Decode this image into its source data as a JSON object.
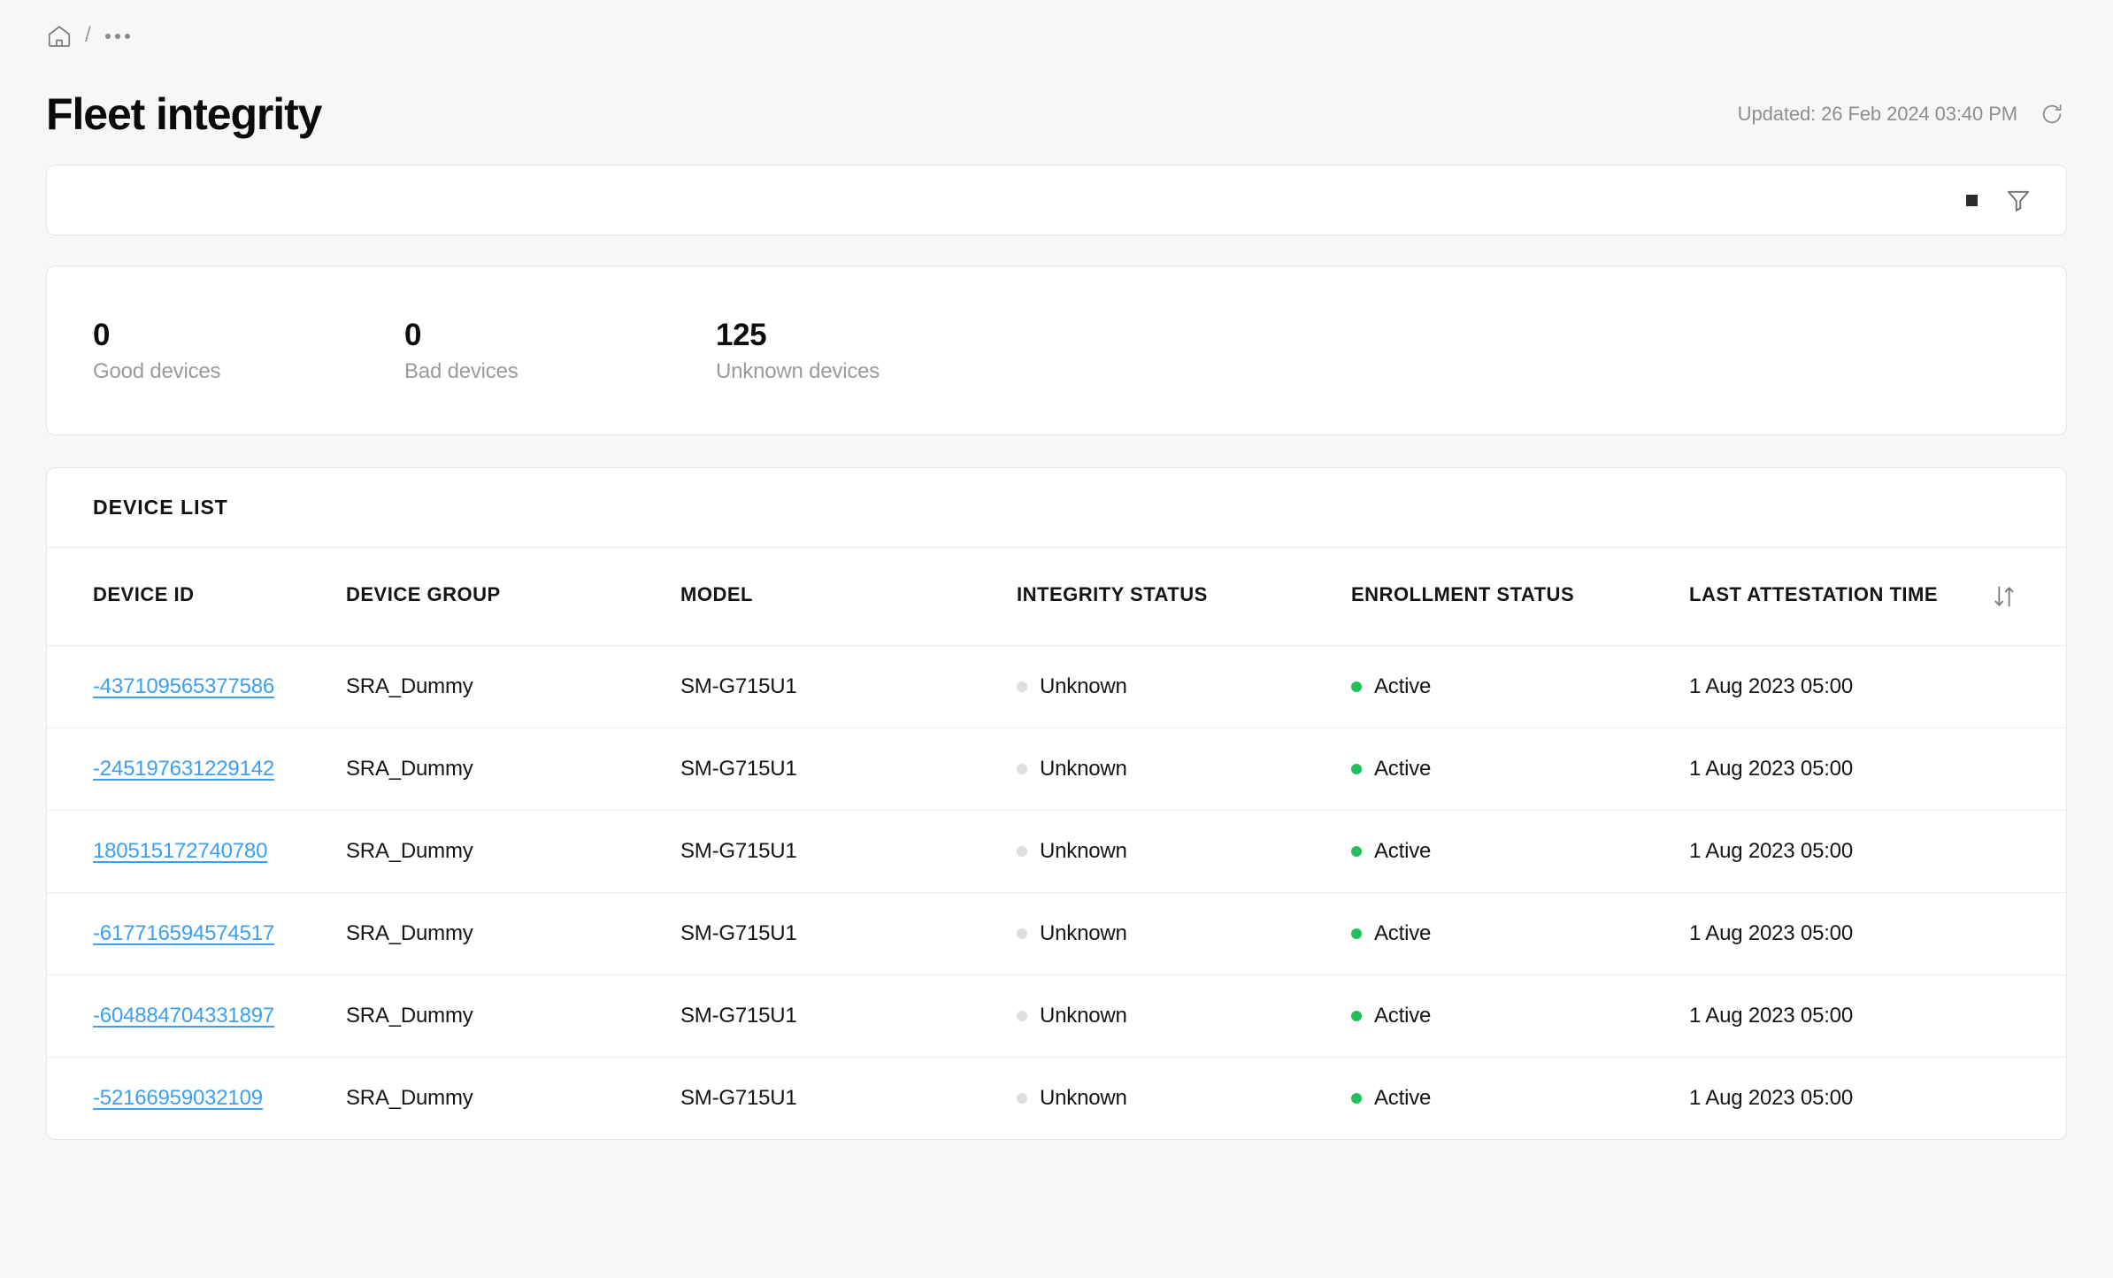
{
  "breadcrumb": {
    "home_icon": "home-icon",
    "separator": "/",
    "ellipsis": "…"
  },
  "header": {
    "title": "Fleet integrity",
    "updated_text": "Updated: 26 Feb 2024 03:40 PM",
    "refresh_icon": "refresh-icon"
  },
  "filter_bar": {
    "square_icon": "square-icon",
    "funnel_icon": "filter-funnel-icon"
  },
  "stats": [
    {
      "value": "0",
      "label": "Good devices"
    },
    {
      "value": "0",
      "label": "Bad devices"
    },
    {
      "value": "125",
      "label": "Unknown devices"
    }
  ],
  "device_list": {
    "section_title": "DEVICE LIST",
    "sort_icon": "sort-arrows-icon",
    "columns": [
      "DEVICE ID",
      "DEVICE GROUP",
      "MODEL",
      "INTEGRITY STATUS",
      "ENROLLMENT STATUS",
      "LAST ATTESTATION TIME"
    ],
    "rows": [
      {
        "device_id": "-437109565377586",
        "device_group": "SRA_Dummy",
        "model": "SM-G715U1",
        "integrity_status": "Unknown",
        "enrollment_status": "Active",
        "last_attestation_time": "1 Aug 2023 05:00"
      },
      {
        "device_id": "-245197631229142",
        "device_group": "SRA_Dummy",
        "model": "SM-G715U1",
        "integrity_status": "Unknown",
        "enrollment_status": "Active",
        "last_attestation_time": "1 Aug 2023 05:00"
      },
      {
        "device_id": "180515172740780",
        "device_group": "SRA_Dummy",
        "model": "SM-G715U1",
        "integrity_status": "Unknown",
        "enrollment_status": "Active",
        "last_attestation_time": "1 Aug 2023 05:00"
      },
      {
        "device_id": "-617716594574517",
        "device_group": "SRA_Dummy",
        "model": "SM-G715U1",
        "integrity_status": "Unknown",
        "enrollment_status": "Active",
        "last_attestation_time": "1 Aug 2023 05:00"
      },
      {
        "device_id": "-604884704331897",
        "device_group": "SRA_Dummy",
        "model": "SM-G715U1",
        "integrity_status": "Unknown",
        "enrollment_status": "Active",
        "last_attestation_time": "1 Aug 2023 05:00"
      },
      {
        "device_id": "-52166959032109",
        "device_group": "SRA_Dummy",
        "model": "SM-G715U1",
        "integrity_status": "Unknown",
        "enrollment_status": "Active",
        "last_attestation_time": "1 Aug 2023 05:00"
      }
    ]
  },
  "colors": {
    "page_background": "#f7f7f7",
    "card_background": "#ffffff",
    "link": "#3a9ff5",
    "status_active": "#21c05b",
    "status_unknown": "#dedede",
    "muted_text": "#9b9b9b",
    "title_text": "#0b0b0b"
  }
}
